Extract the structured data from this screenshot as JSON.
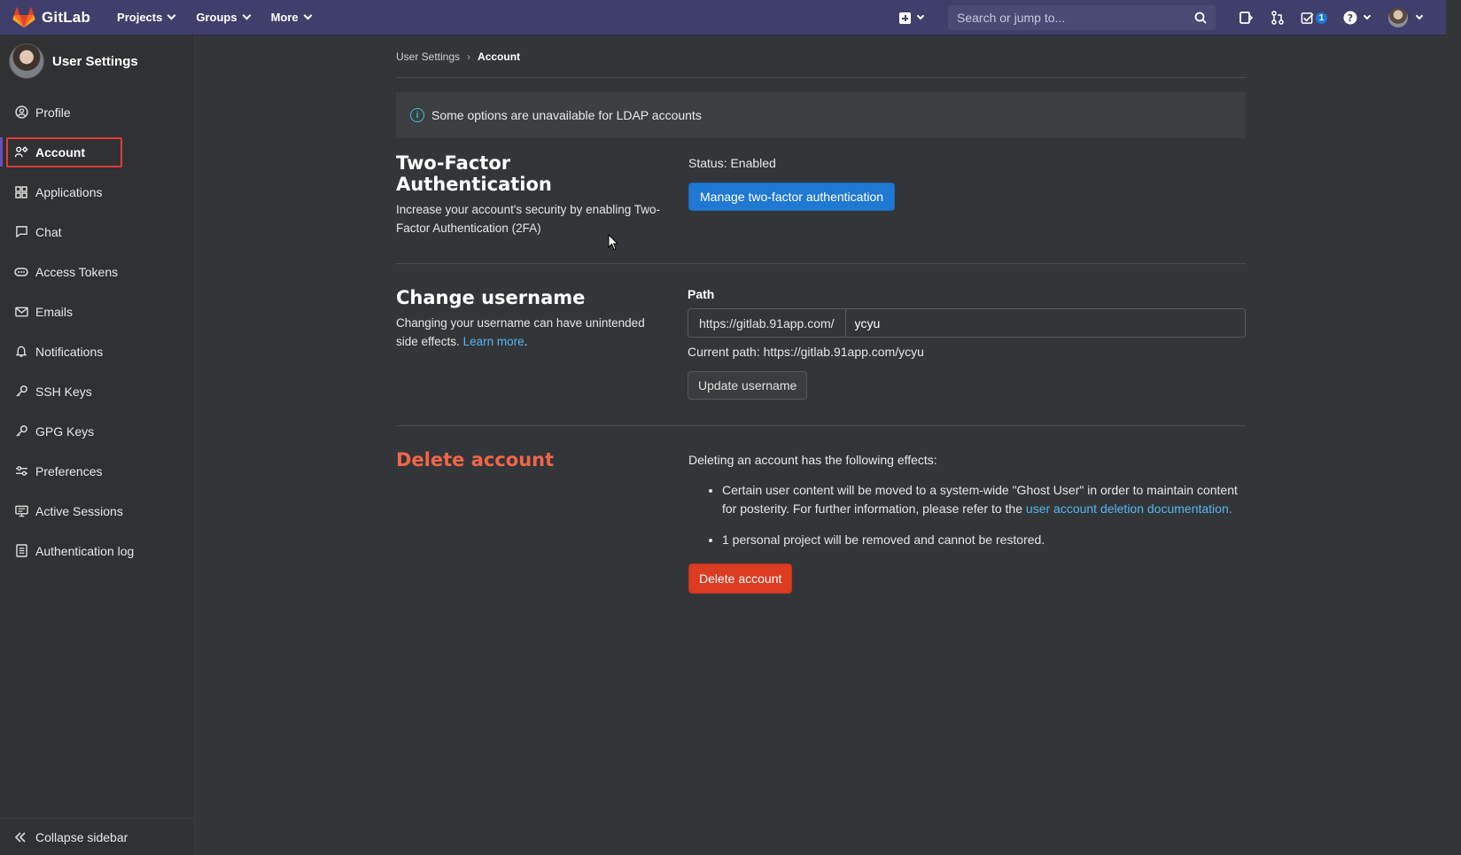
{
  "brand": {
    "name": "GitLab"
  },
  "nav": {
    "menu": [
      "Projects",
      "Groups",
      "More"
    ],
    "search_placeholder": "Search or jump to...",
    "todo_count": "1"
  },
  "sidebar": {
    "title": "User Settings",
    "items": [
      {
        "label": "Profile",
        "icon": "profile-icon"
      },
      {
        "label": "Account",
        "icon": "account-icon",
        "active": true
      },
      {
        "label": "Applications",
        "icon": "applications-icon"
      },
      {
        "label": "Chat",
        "icon": "chat-icon"
      },
      {
        "label": "Access Tokens",
        "icon": "token-icon"
      },
      {
        "label": "Emails",
        "icon": "mail-icon"
      },
      {
        "label": "Notifications",
        "icon": "bell-icon"
      },
      {
        "label": "SSH Keys",
        "icon": "key-icon"
      },
      {
        "label": "GPG Keys",
        "icon": "key-icon"
      },
      {
        "label": "Preferences",
        "icon": "preferences-icon"
      },
      {
        "label": "Active Sessions",
        "icon": "monitor-icon"
      },
      {
        "label": "Authentication log",
        "icon": "log-icon"
      }
    ],
    "collapse_label": "Collapse sidebar"
  },
  "breadcrumb": {
    "parent": "User Settings",
    "current": "Account"
  },
  "alert": {
    "text": "Some options are unavailable for LDAP accounts"
  },
  "two_factor": {
    "title": "Two-Factor Authentication",
    "description": "Increase your account's security by enabling Two-Factor Authentication (2FA)",
    "status": "Status: Enabled",
    "button": "Manage two-factor authentication"
  },
  "username": {
    "title": "Change username",
    "description": "Changing your username can have unintended side effects.",
    "learn_more": "Learn more",
    "path_label": "Path",
    "prefix": "https://gitlab.91app.com/",
    "value": "ycyu",
    "current_path": "Current path: https://gitlab.91app.com/ycyu",
    "button": "Update username"
  },
  "delete": {
    "title": "Delete account",
    "intro": "Deleting an account has the following effects:",
    "effect1": "Certain user content will be moved to a system-wide \"Ghost User\" in order to maintain content for posterity. For further information, please refer to the",
    "effect1_link": "user account deletion documentation",
    "effect2": "1 personal project will be removed and cannot be restored.",
    "button": "Delete account"
  },
  "colors": {
    "navbar": "#403f6b",
    "primary": "#1f78d1",
    "danger": "#db3b21",
    "link": "#55b5f0"
  }
}
